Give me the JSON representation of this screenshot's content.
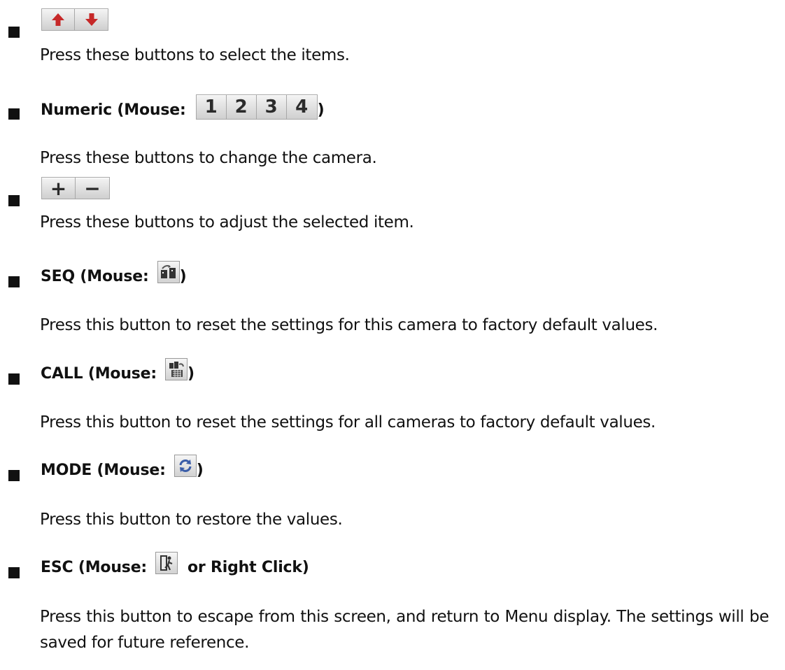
{
  "sections": [
    {
      "id": "arrows",
      "buttons": [
        "up-arrow",
        "down-arrow"
      ],
      "description": "Press these buttons to select the items."
    },
    {
      "id": "numeric",
      "heading": "Numeric (Mouse:",
      "buttons": [
        "1",
        "2",
        "3",
        "4"
      ],
      "close": ")",
      "description": "Press these buttons to change the camera."
    },
    {
      "id": "plusminus",
      "buttons": [
        "+",
        "−"
      ],
      "description": "Press these buttons to adjust the selected item."
    },
    {
      "id": "seq",
      "heading": "SEQ (Mouse:",
      "icon": "seq-icon",
      "close": ")",
      "description": "Press this button to reset the settings for this camera to factory default values."
    },
    {
      "id": "call",
      "heading": "CALL (Mouse:",
      "icon": "call-icon",
      "close": ")",
      "description": "Press this button to reset the settings for all cameras to factory default values."
    },
    {
      "id": "mode",
      "heading": "MODE (Mouse:",
      "icon": "mode-refresh-icon",
      "close": ")",
      "description": "Press this button to restore the values."
    },
    {
      "id": "esc",
      "heading": "ESC (Mouse:",
      "icon": "esc-exit-icon",
      "suffix": "or Right Click)",
      "description": "Press this button to escape from this screen, and return to Menu display.   The settings will be saved for future reference."
    }
  ],
  "colors": {
    "text": "#111111",
    "button_face_top": "#f4f4f4",
    "button_face_bottom": "#cfcfcf",
    "icon_red": "#c62828",
    "icon_dark": "#333333"
  }
}
